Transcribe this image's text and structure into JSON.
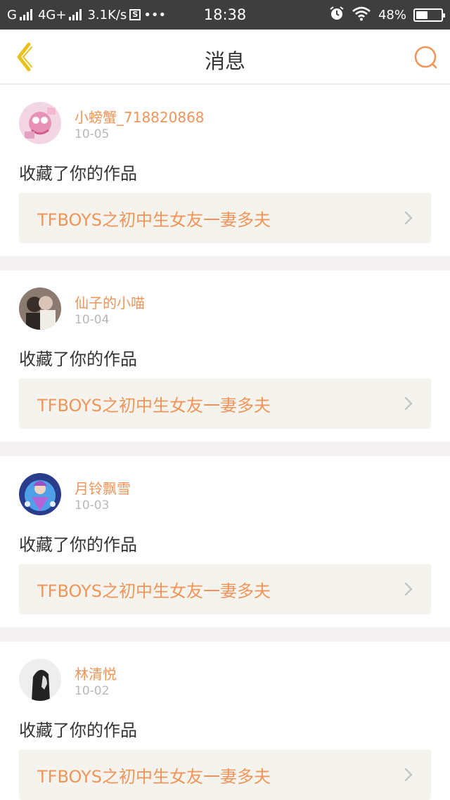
{
  "status_bar": {
    "carrier_prefix": "G",
    "network": "4G+",
    "speed": "3.1K/s",
    "dots": "•••",
    "time": "18:38",
    "battery": "48%",
    "battery_level": 0.48
  },
  "nav": {
    "title": "消息",
    "back_icon": "chevron-left-icon",
    "search_icon": "search-icon",
    "accent_color": "#f0955a",
    "back_color": "#e8c21a"
  },
  "messages": [
    {
      "user": "小螃蟹_718820868",
      "date": "10-05",
      "action": "收藏了你的作品",
      "work_title": "TFBOYS之初中生女友一妻多夫"
    },
    {
      "user": "仙子的小喵",
      "date": "10-04",
      "action": "收藏了你的作品",
      "work_title": "TFBOYS之初中生女友一妻多夫"
    },
    {
      "user": "月铃飘雪",
      "date": "10-03",
      "action": "收藏了你的作品",
      "work_title": "TFBOYS之初中生女友一妻多夫"
    },
    {
      "user": "林清悦",
      "date": "10-02",
      "action": "收藏了你的作品",
      "work_title": "TFBOYS之初中生女友一妻多夫"
    }
  ]
}
